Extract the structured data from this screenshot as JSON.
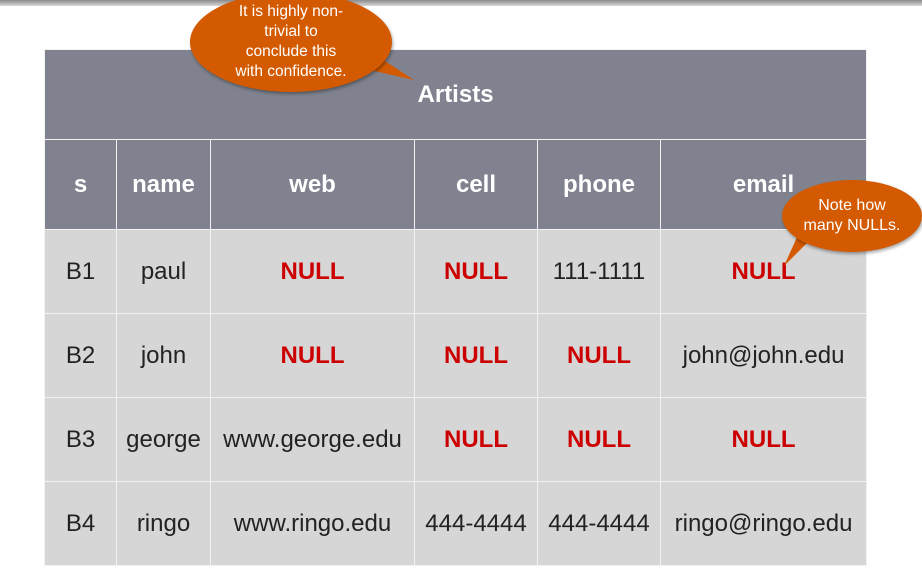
{
  "callouts": {
    "conclusion": "It is highly non-\ntrivial to\nconclude this\nwith confidence.",
    "nulls": "Note how\nmany NULLs."
  },
  "table": {
    "title": "Artists",
    "columns": [
      "s",
      "name",
      "web",
      "cell",
      "phone",
      "email"
    ],
    "rows": [
      [
        "B1",
        "paul",
        "NULL",
        "NULL",
        "111-1111",
        "NULL"
      ],
      [
        "B2",
        "john",
        "NULL",
        "NULL",
        "NULL",
        "john@john.edu"
      ],
      [
        "B3",
        "george",
        "www.george.edu",
        "NULL",
        "NULL",
        "NULL"
      ],
      [
        "B4",
        "ringo",
        "www.ringo.edu",
        "444-4444",
        "444-4444",
        "ringo@ringo.edu"
      ]
    ]
  },
  "colors": {
    "header_bg": "#80838f",
    "body_bg": "#d6d6d7",
    "null_text": "#cc0000",
    "callout_bg": "#d35a00"
  }
}
